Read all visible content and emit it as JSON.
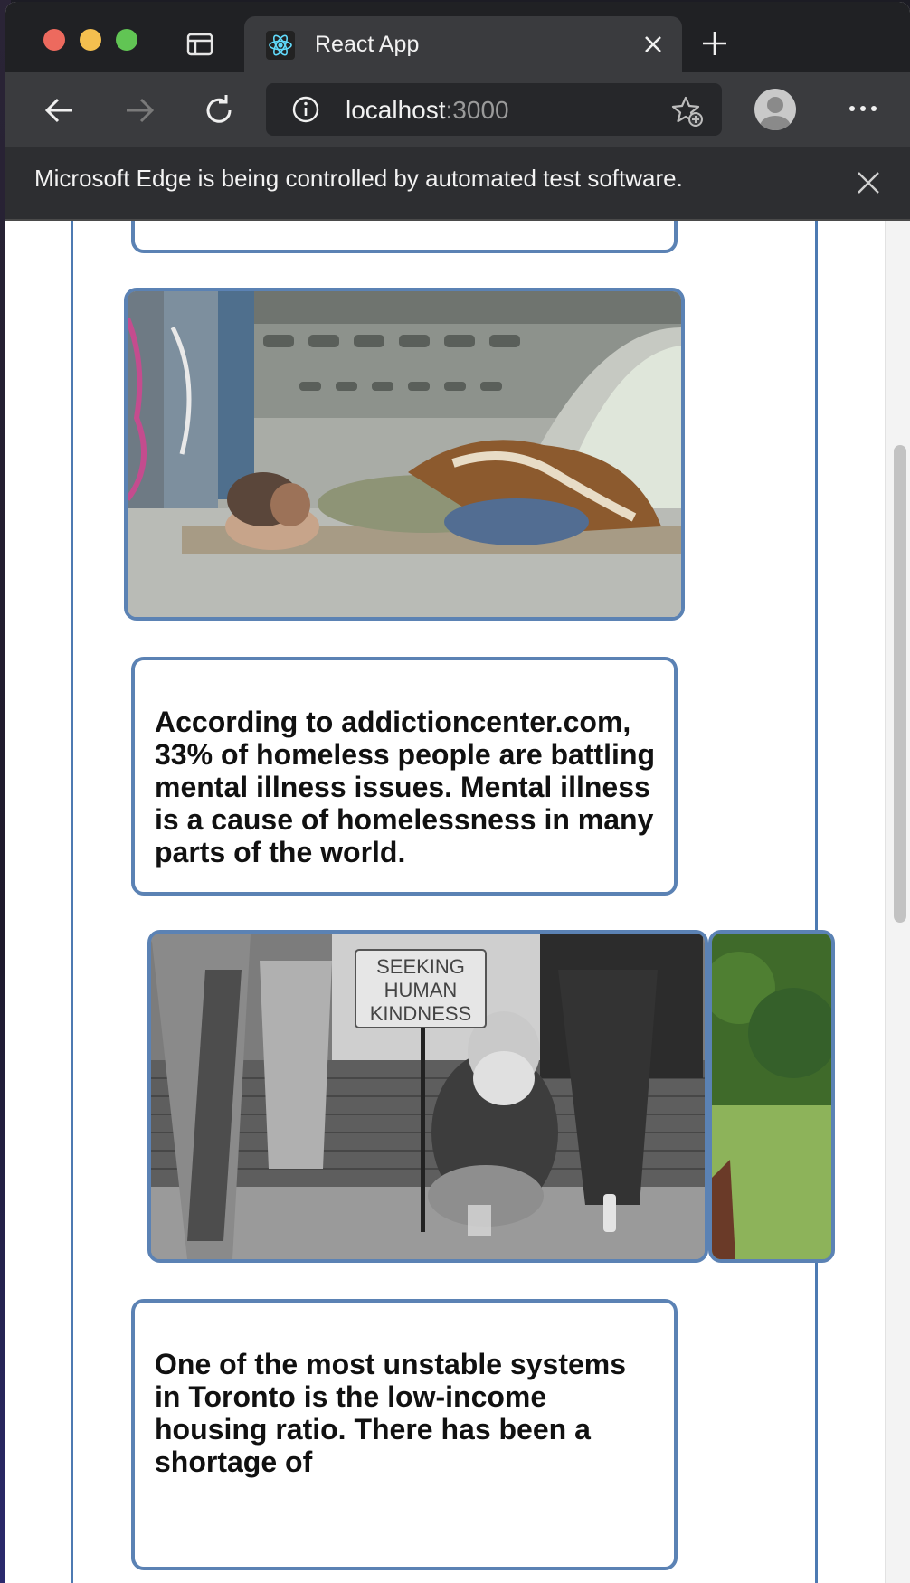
{
  "browser": {
    "tab": {
      "title": "React App",
      "icon": "react-logo-icon"
    },
    "address": {
      "host": "localhost",
      "port": ":3000"
    },
    "infobar": {
      "message": "Microsoft Edge is being controlled by automated test software."
    }
  },
  "page": {
    "cards": [
      {
        "text": "According to addictioncenter.com, 33% of homeless people are battling mental illness issues. Mental illness is a cause of homelessness in many parts of the world."
      },
      {
        "text": "One of the most unstable systems in Toronto is the low-income housing ratio. There has been a shortage of"
      }
    ],
    "images": [
      {
        "subject": "man-sleeping-under-bridge"
      },
      {
        "subject": "man-with-sign",
        "sign_lines": [
          "SEEKING",
          "HUMAN",
          "KINDNESS"
        ]
      },
      {
        "subject": "park-grass"
      }
    ]
  },
  "colors": {
    "card_border": "#5b82b4",
    "container_border": "#4d7ab2"
  }
}
